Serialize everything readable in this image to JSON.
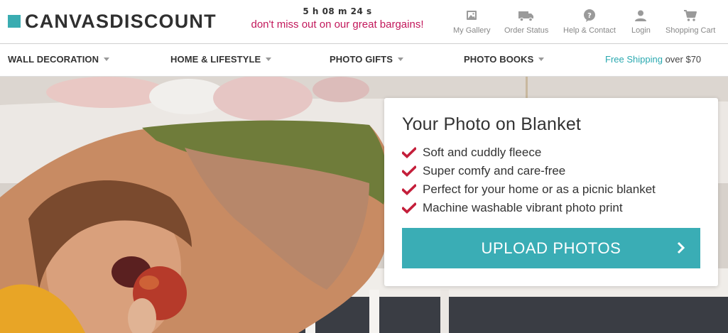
{
  "brand": {
    "name": "CANVASDISCOUNT",
    "color": "#3aacb1"
  },
  "countdown": {
    "time": "5 h 08 m 24 s",
    "message": "don't miss out on our great bargains!",
    "message_color": "#c2185b"
  },
  "utility_nav": [
    {
      "label": "My Gallery",
      "icon": "gallery-icon"
    },
    {
      "label": "Order Status",
      "icon": "truck-icon"
    },
    {
      "label": "Help & Contact",
      "icon": "help-icon"
    },
    {
      "label": "Login",
      "icon": "user-icon"
    },
    {
      "label": "Shopping Cart",
      "icon": "cart-icon"
    }
  ],
  "main_nav": [
    {
      "label": "WALL DECORATION"
    },
    {
      "label": "HOME & LIFESTYLE"
    },
    {
      "label": "PHOTO GIFTS"
    },
    {
      "label": "PHOTO BOOKS"
    }
  ],
  "shipping": {
    "link": "Free Shipping",
    "rest": " over $70",
    "link_color": "#2aa9b0"
  },
  "hero": {
    "title": "Your Photo on Blanket",
    "features": [
      "Soft and cuddly fleece",
      "Super comfy and care-free",
      "Perfect for your home or as a picnic blanket",
      "Machine washable vibrant photo print"
    ],
    "cta": "UPLOAD PHOTOS",
    "cta_color": "#3aadb5",
    "check_color": "#c41e3a"
  }
}
